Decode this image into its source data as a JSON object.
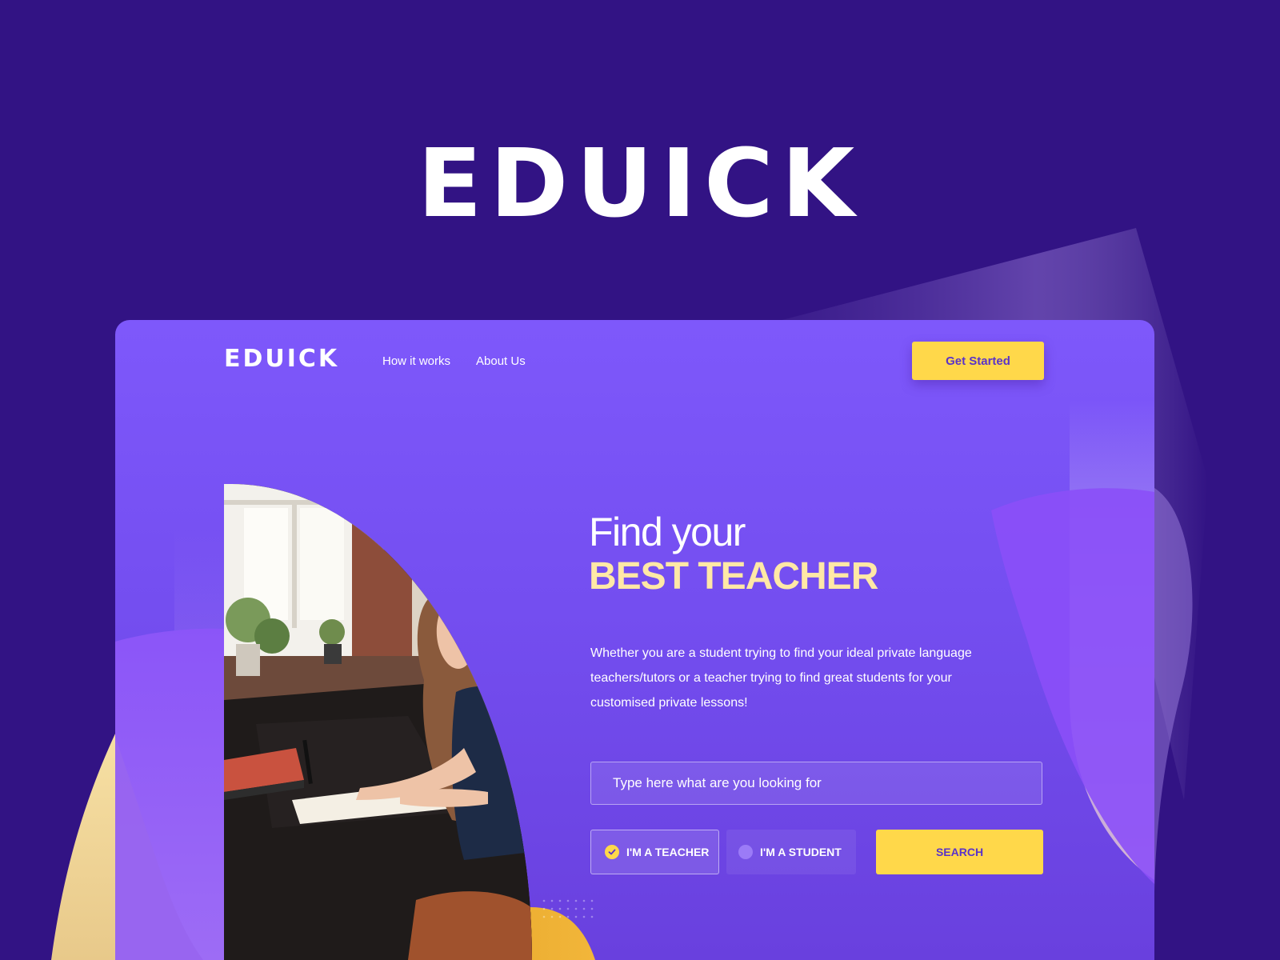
{
  "brand": {
    "logo_text": "EDUICK"
  },
  "nav": {
    "logo_text": "EDUICK",
    "links": [
      "How it works",
      "About Us"
    ],
    "cta_label": "Get Started"
  },
  "hero": {
    "line1": "Find your",
    "line2": "BEST TEACHER",
    "description": "Whether you are a student trying to find your ideal private language teachers/tutors or a teacher trying to find great students for your customised private lessons!"
  },
  "search": {
    "placeholder": "Type here what are you looking for",
    "value": "",
    "roles": [
      {
        "label": "I'M A TEACHER",
        "selected": true
      },
      {
        "label": "I'M A STUDENT",
        "selected": false
      }
    ],
    "button_label": "SEARCH"
  },
  "colors": {
    "page_background": "#321384",
    "card_background": "#7e58fb",
    "accent_yellow": "#ffd84a",
    "headline_highlight": "#ffe8a6",
    "button_text": "#5a33c9"
  },
  "icons": [
    "check-icon",
    "decorative-dots-icon"
  ]
}
